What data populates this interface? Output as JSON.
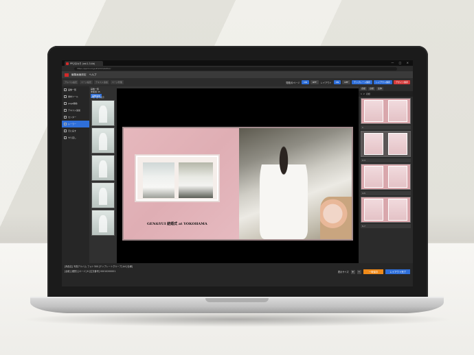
{
  "browser": {
    "tab_title": "PPひまわり (vol.1.3.4b)",
    "url": "https://ppcloud.jp/#/2213/editor/",
    "controls": "— □ ×"
  },
  "menu": {
    "items": [
      "編集画面設定",
      "ヘルプ"
    ]
  },
  "toolbar": {
    "tabs": [
      "アルバム設定",
      "ページ設定",
      "テキスト追加",
      "ページ管理"
    ],
    "view_label": "見開/片ページ",
    "on_label": "ON",
    "off_label": "OFF",
    "layout_label": "レイアウト",
    "template_btn": "テンプレート保存",
    "layout_btn": "レイアウト保存",
    "design_btn": "デザイン保存"
  },
  "left_tools": {
    "items": [
      "画像一覧",
      "素材ツール",
      "page移動",
      "テキスト追加",
      "センター",
      "ルーラー",
      "元に戻す",
      "やり直し"
    ]
  },
  "thumbs": {
    "head": "画像一覧",
    "sub": "未使用 45",
    "btn": "画像追加",
    "filter_a": "1枚",
    "filter_b": "全て表示"
  },
  "album": {
    "names": "GEN&YUI 結婚式 at YOKOHAMA"
  },
  "right_panel": {
    "tabs": [
      "表紙",
      "台紙",
      "全体"
    ],
    "bar": [
      "1",
      "2",
      "表紙"
    ],
    "labels": [
      "1",
      "2-3",
      "4-5",
      "6-7"
    ]
  },
  "status": {
    "line1": "[商品名] 写真アルバム フォト300 [テンプレートグループ] A4 [仕様]",
    "line2": "[台紙] [種別] [ページ] 6 [注文番号] 00010200001",
    "zoom_label": "表示サイズ",
    "zoom_in": "+",
    "zoom_out": "−",
    "order_btn": "一時保存",
    "layout_btn": "レイアウト完了"
  },
  "colors": {
    "accent_blue": "#2f6fd9",
    "accent_red": "#d43b3b",
    "accent_orange": "#ef8a1a",
    "album_pink": "#e6b8bd"
  }
}
